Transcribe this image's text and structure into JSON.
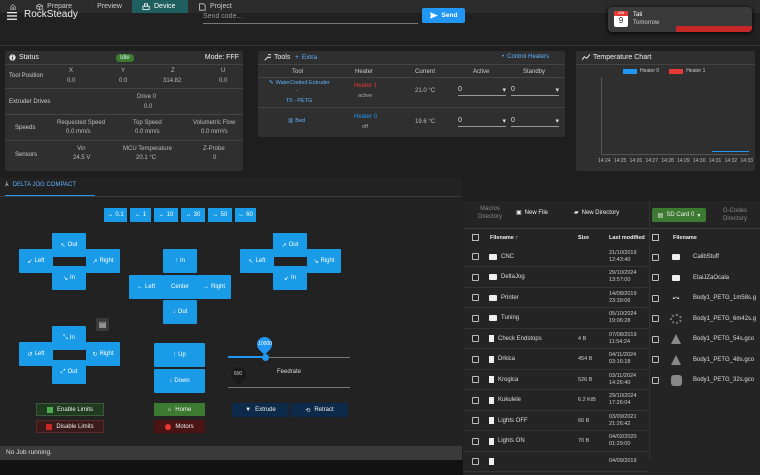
{
  "tabs": [
    {
      "label": "",
      "icon": "home-icon"
    },
    {
      "label": "Prepare",
      "icon": "cube-icon"
    },
    {
      "label": "Preview",
      "icon": "cube-outline-icon"
    },
    {
      "label": "Device",
      "icon": "printer-icon"
    },
    {
      "label": "Project",
      "icon": "document-icon"
    }
  ],
  "header": {
    "title": "RockSteady",
    "code_placeholder": "Send code...",
    "send_label": "Send"
  },
  "notification": {
    "month": "JAN",
    "day": "9",
    "title": "Tati",
    "subtitle": "Tomorrow"
  },
  "status": {
    "title": "Status",
    "state": "Idle",
    "mode": "Mode: FFF",
    "tool_position": {
      "label": "Tool Position",
      "axes": [
        "X",
        "Y",
        "Z",
        "U"
      ],
      "values": [
        "0.0",
        "0.0",
        "314.82",
        "0.0"
      ]
    },
    "extruder": {
      "label": "Extruder Drives",
      "drive": "Drive 0",
      "value": "0.0"
    },
    "speeds": {
      "label": "Speeds",
      "cols": [
        "Requested Speed",
        "Top Speed",
        "Volumetric Flow"
      ],
      "values": [
        "0.0 mm/s",
        "0.0 mm/s",
        "0.0 mm³/s"
      ]
    },
    "sensors": {
      "label": "Sensors",
      "cols": [
        "Vin",
        "MCU Temperature",
        "Z-Probe"
      ],
      "values": [
        "24.5 V",
        "20.1 °C",
        "0"
      ]
    }
  },
  "tools": {
    "title": "Tools",
    "extra": "Extra",
    "control_heaters": "Control Heaters",
    "headers": [
      "Tool",
      "Heater",
      "Current",
      "Active",
      "Standby"
    ],
    "rows": [
      {
        "tool": "WaterCooled Extruder",
        "tool2": "T0 - PETG",
        "heater": "Heater 1",
        "heater_state": "active",
        "current": "21.0 °C",
        "active": "0",
        "standby": "0"
      },
      {
        "tool": "Bed",
        "tool2": "",
        "heater": "Heater 0",
        "heater_state": "off",
        "current": "19.6 °C",
        "active": "0",
        "standby": "0"
      }
    ]
  },
  "temp_chart": {
    "title": "Temperature Chart",
    "legend": [
      {
        "name": "Heater 0",
        "color": "#2196f3"
      },
      {
        "name": "Heater 1",
        "color": "#e53935"
      }
    ],
    "times": [
      "14:24",
      "14:25",
      "14:26",
      "14:27",
      "14:28",
      "14:29",
      "14:30",
      "14:31",
      "14:32",
      "14:33"
    ]
  },
  "jog": {
    "tab": "DELTA JOG COMPACT",
    "steps": [
      "0.1",
      "1",
      "10",
      "30",
      "50",
      "60"
    ],
    "out": "Out",
    "in": "In",
    "left": "Left",
    "right": "Right",
    "center": "Center",
    "up": "Up",
    "down": "Down",
    "feedrate_label": "Feedrate",
    "feedrate_value": "10000",
    "feedrate_min": "600",
    "enable_limits": "Enable Limits",
    "disable_limits": "Disable Limits",
    "home": "Home",
    "motors": "Motors",
    "extrude": "Extrude",
    "retract": "Retract"
  },
  "status_bar": "No Job running.",
  "files": {
    "tabs": [
      "Macros",
      "Directory"
    ],
    "new_file": "New File",
    "new_directory": "New Directory",
    "headers": [
      "Filename",
      "Size",
      "Last modified"
    ],
    "rows": [
      {
        "name": "CNC",
        "type": "folder",
        "size": "",
        "date": "21/10/2019",
        "time": "12:43:40"
      },
      {
        "name": "DeltaJog",
        "type": "folder",
        "size": "",
        "date": "29/10/2024",
        "time": "13:57:00"
      },
      {
        "name": "Printer",
        "type": "folder",
        "size": "",
        "date": "14/08/2019",
        "time": "23:39:06"
      },
      {
        "name": "Tuning",
        "type": "folder",
        "size": "",
        "date": "05/10/2024",
        "time": "19:06:28"
      },
      {
        "name": "Check Endstops",
        "type": "file",
        "size": "4 B",
        "date": "07/08/2019",
        "time": "11:54:24"
      },
      {
        "name": "Drkica",
        "type": "file",
        "size": "454 B",
        "date": "04/11/2024",
        "time": "03:16:18"
      },
      {
        "name": "Krogica",
        "type": "file",
        "size": "526 B",
        "date": "03/11/2024",
        "time": "14:26:40"
      },
      {
        "name": "Kukulele",
        "type": "file",
        "size": "6.2 KiB",
        "date": "29/10/2024",
        "time": "17:26:04"
      },
      {
        "name": "Lights OFF",
        "type": "file",
        "size": "66 B",
        "date": "03/09/2021",
        "time": "21:26:42"
      },
      {
        "name": "Lights ON",
        "type": "file",
        "size": "70 B",
        "date": "04/02/2020",
        "time": "01:29:00"
      },
      {
        "name": "",
        "type": "file",
        "size": "",
        "date": "04/09/2019",
        "time": ""
      }
    ]
  },
  "sd": {
    "button": "SD Card 0",
    "gcodes": "G-Codes",
    "directory": "Directory",
    "header": "Filename",
    "rows": [
      {
        "name": "CalibStuff",
        "icon": "folder-icon"
      },
      {
        "name": "EtaiJZaOcala",
        "icon": "folder-icon"
      },
      {
        "name": "Body1_PETG_1m58s.g",
        "icon": "model-icon"
      },
      {
        "name": "Body1_PETG_6m42s.g",
        "icon": "ring-icon"
      },
      {
        "name": "Body1_PETG_54s.gco",
        "icon": "cone-icon"
      },
      {
        "name": "Body1_PETG_48s.gco",
        "icon": "cone-icon"
      },
      {
        "name": "Body1_PETG_32s.gco",
        "icon": "cylinder-icon"
      }
    ]
  },
  "colors": {
    "accent": "#2196f3",
    "idle_chip": "#3d7a31",
    "heater_active": "#e53935",
    "heater_off": "#2196f3",
    "green_btn": "#4caf50",
    "red_btn": "#c62828"
  }
}
